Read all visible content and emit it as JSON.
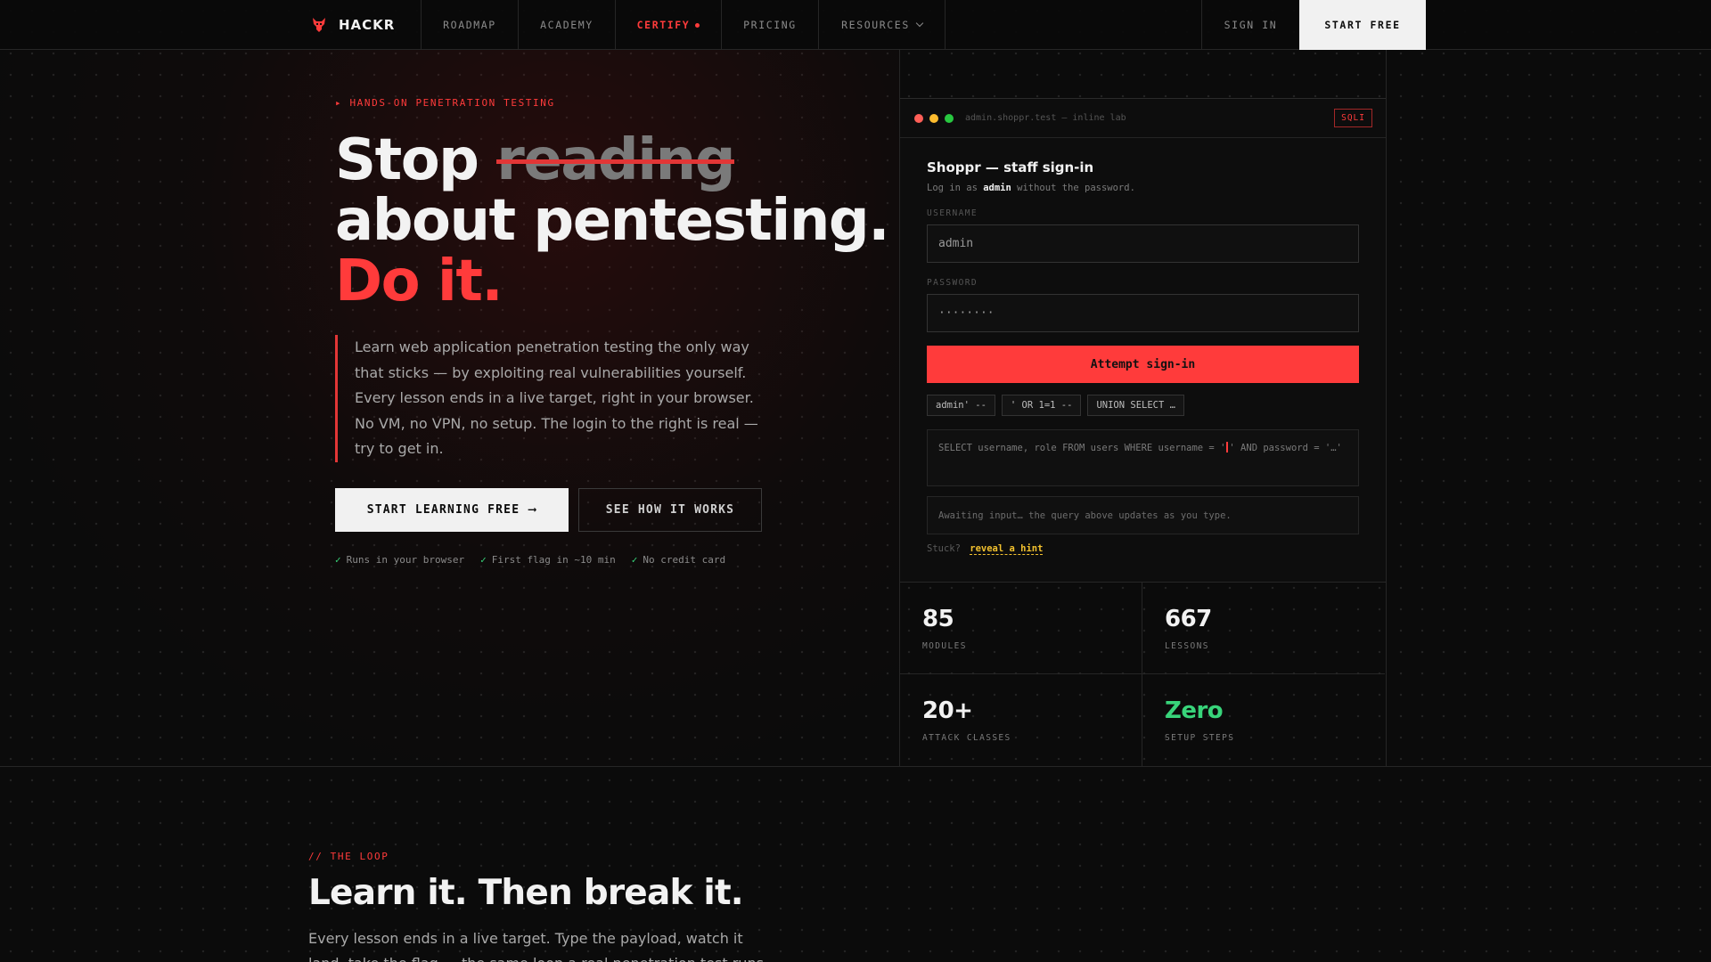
{
  "nav": {
    "brand": "HACKR",
    "items": [
      {
        "label": "ROADMAP"
      },
      {
        "label": "ACADEMY"
      },
      {
        "label": "CERTIFY"
      },
      {
        "label": "PRICING"
      },
      {
        "label": "RESOURCES"
      }
    ],
    "sign_in": "SIGN IN",
    "start_free": "START FREE",
    "accent_color": "#ff3b3b"
  },
  "hero": {
    "eyebrow": "▸ HANDS-ON PENETRATION TESTING",
    "headline_word1": "Stop ",
    "headline_struck": "reading",
    "headline_line2": "about pentesting.",
    "headline_line3": "Do it.",
    "lede": "Learn web application penetration testing the only way that sticks — by exploiting real vulnerabilities yourself. Every lesson ends in a live target, right in your browser. No VM, no VPN, no setup. The login to the right is real — try to get in.",
    "cta_primary": "START LEARNING FREE",
    "cta_primary_arrow": "⟶",
    "cta_secondary": "SEE HOW IT WORKS",
    "perks": [
      "Runs in your browser",
      "First flag in ~10 min",
      "No credit card"
    ],
    "check_glyph": "✓"
  },
  "lab": {
    "url": "admin.shoppr.test — inline lab",
    "badge": "SQLI",
    "title": "Shoppr — staff sign-in",
    "subtitle_pre": "Log in as ",
    "subtitle_user": "admin",
    "subtitle_post": " without the password.",
    "username_label": "USERNAME",
    "username_value": "admin",
    "password_label": "PASSWORD",
    "password_value": "········",
    "submit": "Attempt sign-in",
    "payload_chips": [
      "admin' --",
      "' OR 1=1 --",
      "UNION SELECT …"
    ],
    "query_pre": "SELECT username, role FROM users WHERE username = '",
    "query_post": "' AND password = '…'",
    "status": "Awaiting input… the query above updates as you type.",
    "hint_prefix": "Stuck?",
    "hint_link": "reveal a hint",
    "traffic_lights": [
      "#ff5f57",
      "#febc2e",
      "#28c840"
    ]
  },
  "stats": [
    {
      "value": "85",
      "label": "MODULES"
    },
    {
      "value": "667",
      "label": "LESSONS"
    },
    {
      "value": "20+",
      "label": "ATTACK CLASSES"
    },
    {
      "value": "Zero",
      "label": "SETUP STEPS"
    }
  ],
  "loop": {
    "eyebrow": "// THE LOOP",
    "title": "Learn it. Then break it.",
    "body": "Every lesson ends in a live target. Type the payload, watch it land, take the flag — the same loop a real penetration test runs on."
  }
}
